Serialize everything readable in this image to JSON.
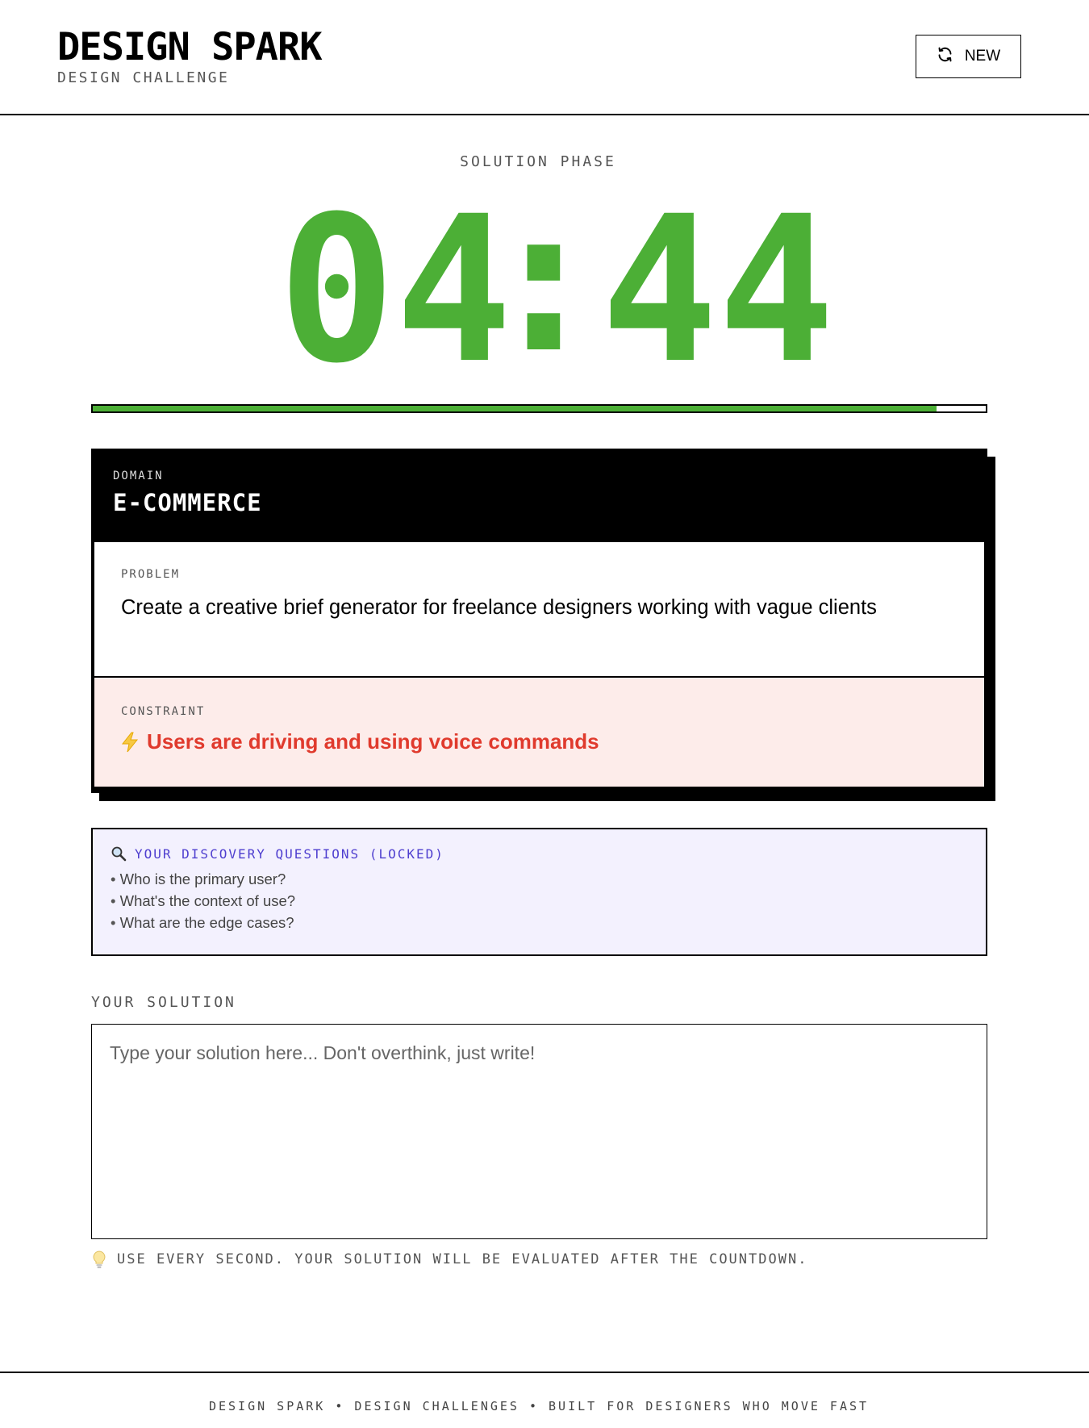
{
  "header": {
    "title": "DESIGN SPARK",
    "subtitle": "DESIGN CHALLENGE",
    "new_button_label": "NEW",
    "new_button_icon": "refresh-icon"
  },
  "timer": {
    "phase": "SOLUTION PHASE",
    "minutes": "04",
    "separator": ":",
    "seconds": "44",
    "color": "#4caf36",
    "progress_percent": 94.5
  },
  "challenge": {
    "domain_label": "DOMAIN",
    "domain": "E-COMMERCE",
    "problem_label": "PROBLEM",
    "problem": "Create a creative brief generator for freelance designers working with vague clients",
    "constraint_label": "CONSTRAINT",
    "constraint_icon": "lightning-icon",
    "constraint": "Users are driving and using voice commands",
    "constraint_color": "#e03a2d"
  },
  "discovery": {
    "icon": "search-icon",
    "title": "YOUR DISCOVERY QUESTIONS (LOCKED)",
    "questions": [
      "Who is the primary user?",
      "What's the context of use?",
      "What are the edge cases?"
    ]
  },
  "solution": {
    "label": "YOUR SOLUTION",
    "value": "",
    "placeholder": "Type your solution here... Don't overthink, just write!",
    "hint_icon": "lightbulb-icon",
    "hint": "USE EVERY SECOND. YOUR SOLUTION WILL BE EVALUATED AFTER THE COUNTDOWN."
  },
  "footer": {
    "text": "DESIGN SPARK • DESIGN CHALLENGES • BUILT FOR DESIGNERS WHO MOVE FAST"
  }
}
